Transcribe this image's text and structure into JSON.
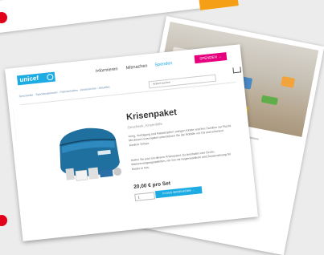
{
  "header": {
    "logo_text": "unicef",
    "nav": [
      "Informieren",
      "Mitmachen",
      "Spenden"
    ],
    "donate_button": "SPENDEN →",
    "subnav": "Geschenke · Spendenaktionen · Patenschaften · Kinderrechte · Aktuelles",
    "search_placeholder": "Artikel suchen"
  },
  "product": {
    "title": "Krisenpaket",
    "subtitle": "Geschenk, Krisenhilfe",
    "description_1": "Krieg, Verfolgung und Katastrophen zwingen Kinder und ihre Familien zur Flucht. Mit diesem Krisenpaket unterstützen Sie die Nothilfe vor Ort und schenken Kindern Schutz.",
    "description_2": "Helfen Sie jetzt mit diesem Krisenpaket. Es beinhaltet eine Decke, Wasserreinigungstabletten, ein Set mit Hygieneartikeln und Zusatznahrung für Kinder in Not.",
    "price": "20,00 € pro Set",
    "quantity": "1",
    "cart_button": "IN DEN WARENKORB →"
  },
  "colors": {
    "brand": "#1cabe2",
    "donate": "#e6007e",
    "accent_orange": "#f49f16",
    "marker": "#e2001a"
  }
}
